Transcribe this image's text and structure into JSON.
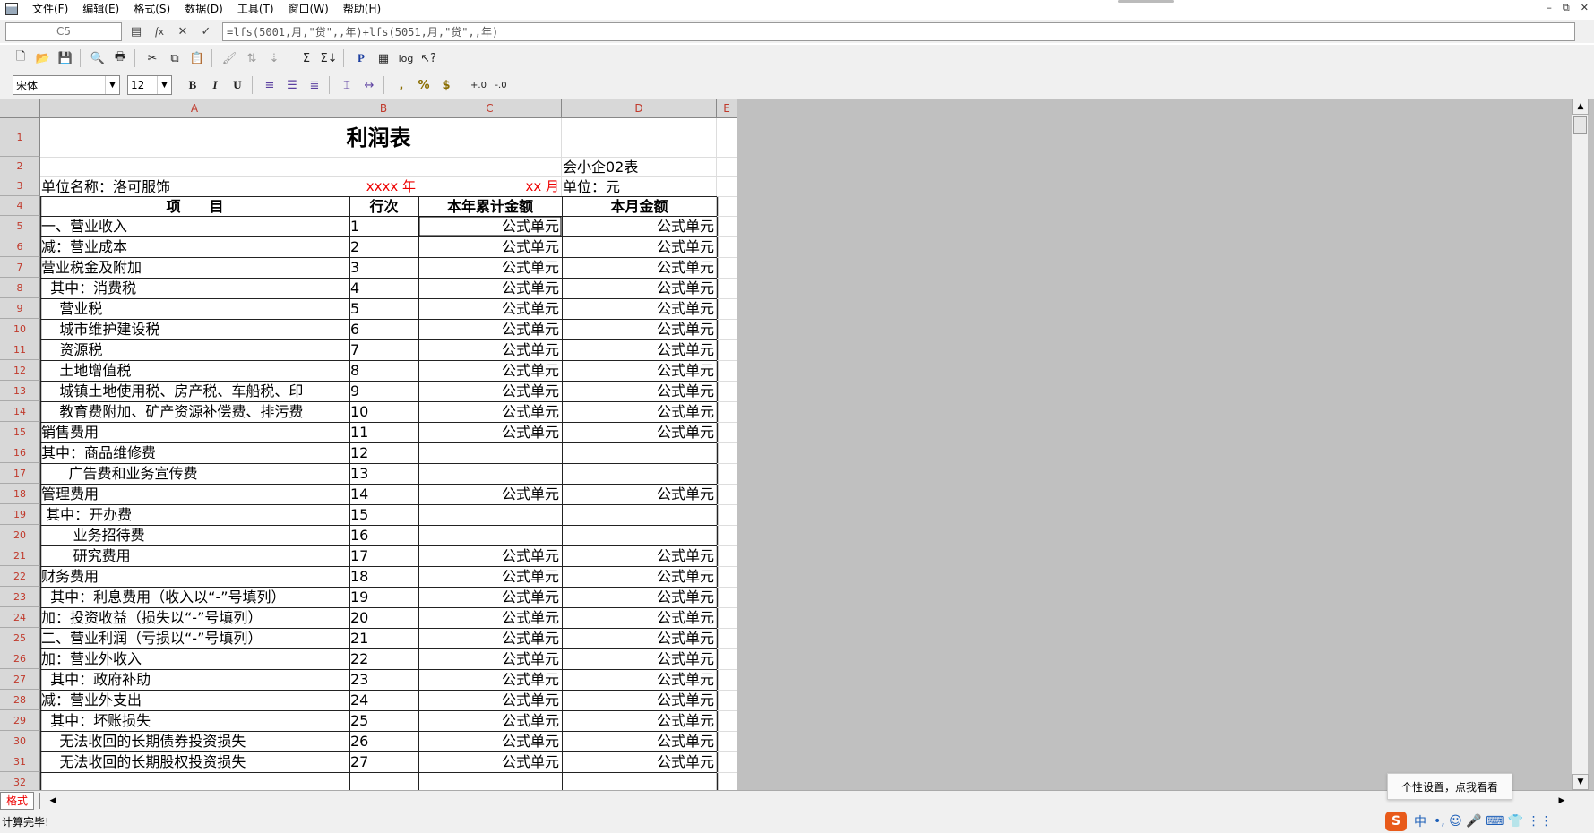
{
  "menu": [
    "文件(F)",
    "编辑(E)",
    "格式(S)",
    "数据(D)",
    "工具(T)",
    "窗口(W)",
    "帮助(H)"
  ],
  "window_controls": [
    "–",
    "⧉",
    "✕"
  ],
  "formula_bar": {
    "cell_ref": "C5",
    "formula": "=lfs(5001,月,\"贷\",,年)+lfs(5051,月,\"贷\",,年)"
  },
  "font_toolbar": {
    "font_name": "宋体",
    "font_size": "12",
    "bold": "B",
    "italic": "I",
    "underline": "U"
  },
  "toolbar_labels": {
    "sum": "Σ",
    "sigma_down": "Σ↓",
    "p": "P",
    "log": "log",
    "comma": ",",
    "percent": "%",
    "dollar": "$",
    "inc_decimal": "+.0",
    "dec_decimal": "-.0"
  },
  "columns": [
    "A",
    "B",
    "C",
    "D",
    "E"
  ],
  "rows": [
    {
      "n": "1",
      "a": "",
      "b": "",
      "c": "",
      "d": ""
    },
    {
      "n": "2",
      "a": "",
      "b": "",
      "c": "",
      "d": "会小企02表"
    },
    {
      "n": "3",
      "a": "单位名称：洛可服饰",
      "b": "xxxx 年",
      "c": "xx 月",
      "d": "单位：元"
    },
    {
      "n": "4",
      "a": "项　　目",
      "b": "行次",
      "c": "本年累计金额",
      "d": "本月金额"
    },
    {
      "n": "5",
      "a": "一、营业收入",
      "b": "1",
      "c": "公式单元",
      "d": "公式单元"
    },
    {
      "n": "6",
      "a": "减：营业成本",
      "b": "2",
      "c": "公式单元",
      "d": "公式单元"
    },
    {
      "n": "7",
      "a": "营业税金及附加",
      "b": "3",
      "c": "公式单元",
      "d": "公式单元"
    },
    {
      "n": "8",
      "a": "  其中：消费税",
      "b": "4",
      "c": "公式单元",
      "d": "公式单元"
    },
    {
      "n": "9",
      "a": "    营业税",
      "b": "5",
      "c": "公式单元",
      "d": "公式单元"
    },
    {
      "n": "10",
      "a": "    城市维护建设税",
      "b": "6",
      "c": "公式单元",
      "d": "公式单元"
    },
    {
      "n": "11",
      "a": "    资源税",
      "b": "7",
      "c": "公式单元",
      "d": "公式单元"
    },
    {
      "n": "12",
      "a": "    土地增值税",
      "b": "8",
      "c": "公式单元",
      "d": "公式单元"
    },
    {
      "n": "13",
      "a": "    城镇土地使用税、房产税、车船税、印",
      "b": "9",
      "c": "公式单元",
      "d": "公式单元"
    },
    {
      "n": "14",
      "a": "    教育费附加、矿产资源补偿费、排污费",
      "b": "10",
      "c": "公式单元",
      "d": "公式单元"
    },
    {
      "n": "15",
      "a": "销售费用",
      "b": "11",
      "c": "公式单元",
      "d": "公式单元"
    },
    {
      "n": "16",
      "a": "其中：商品维修费",
      "b": "12",
      "c": "",
      "d": ""
    },
    {
      "n": "17",
      "a": "      广告费和业务宣传费",
      "b": "13",
      "c": "",
      "d": ""
    },
    {
      "n": "18",
      "a": "管理费用",
      "b": "14",
      "c": "公式单元",
      "d": "公式单元"
    },
    {
      "n": "19",
      "a": " 其中：开办费",
      "b": "15",
      "c": "",
      "d": ""
    },
    {
      "n": "20",
      "a": "       业务招待费",
      "b": "16",
      "c": "",
      "d": ""
    },
    {
      "n": "21",
      "a": "       研究费用",
      "b": "17",
      "c": "公式单元",
      "d": "公式单元"
    },
    {
      "n": "22",
      "a": "财务费用",
      "b": "18",
      "c": "公式单元",
      "d": "公式单元"
    },
    {
      "n": "23",
      "a": "  其中：利息费用（收入以“-”号填列）",
      "b": "19",
      "c": "公式单元",
      "d": "公式单元"
    },
    {
      "n": "24",
      "a": "加：投资收益（损失以“-”号填列）",
      "b": "20",
      "c": "公式单元",
      "d": "公式单元"
    },
    {
      "n": "25",
      "a": "二、营业利润（亏损以“-”号填列）",
      "b": "21",
      "c": "公式单元",
      "d": "公式单元"
    },
    {
      "n": "26",
      "a": "加：营业外收入",
      "b": "22",
      "c": "公式单元",
      "d": "公式单元"
    },
    {
      "n": "27",
      "a": "  其中：政府补助",
      "b": "23",
      "c": "公式单元",
      "d": "公式单元"
    },
    {
      "n": "28",
      "a": "减：营业外支出",
      "b": "24",
      "c": "公式单元",
      "d": "公式单元"
    },
    {
      "n": "29",
      "a": "  其中：坏账损失",
      "b": "25",
      "c": "公式单元",
      "d": "公式单元"
    },
    {
      "n": "30",
      "a": "    无法收回的长期债券投资损失",
      "b": "26",
      "c": "公式单元",
      "d": "公式单元"
    },
    {
      "n": "31",
      "a": "    无法收回的长期股权投资损失",
      "b": "27",
      "c": "公式单元",
      "d": "公式单元"
    },
    {
      "n": "32",
      "a": "",
      "b": "",
      "c": "",
      "d": ""
    }
  ],
  "report_title": "利润表",
  "sheet_tab": "格式",
  "status_text": "计算完毕!",
  "tooltip": "个性设置，点我看看",
  "ime": {
    "logo": "S",
    "lang": "中",
    "icons": "•, ☺ 🎤 ⌨ 👕 ⋮⋮"
  },
  "colors": {
    "header_red": "#c0392b",
    "text_red": "#ee0000",
    "sheet_bg": "#c0c0c0",
    "ime_logo": "#e85a1a"
  }
}
